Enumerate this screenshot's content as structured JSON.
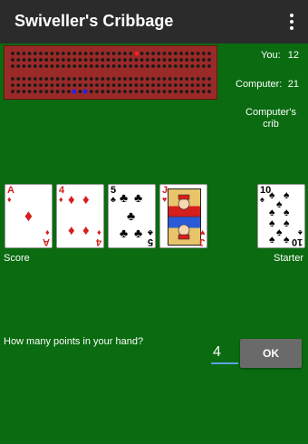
{
  "app": {
    "title": "Swiveller's Cribbage",
    "menu_icon": "more-vert-icon"
  },
  "scores": [
    {
      "label": "You:",
      "value": "12"
    },
    {
      "label": "Computer:",
      "value": "21"
    }
  ],
  "crib_label": "Computer's crib",
  "hand": [
    {
      "rank": "A",
      "suit": "♦",
      "color": "red"
    },
    {
      "rank": "4",
      "suit": "♦",
      "color": "red"
    },
    {
      "rank": "5",
      "suit": "♣",
      "color": "black"
    },
    {
      "rank": "J",
      "suit": "♥",
      "color": "red"
    }
  ],
  "starter": {
    "rank": "10",
    "suit": "♠",
    "color": "black"
  },
  "labels": {
    "score": "Score",
    "starter": "Starter"
  },
  "prompt": {
    "question": "How many points in your hand?",
    "input_value": "4",
    "ok_label": "OK"
  },
  "colors": {
    "felt": "#0a6b10",
    "board": "#9a2a28",
    "appbar": "#2b2b2b",
    "accent": "#5aa3e5"
  }
}
